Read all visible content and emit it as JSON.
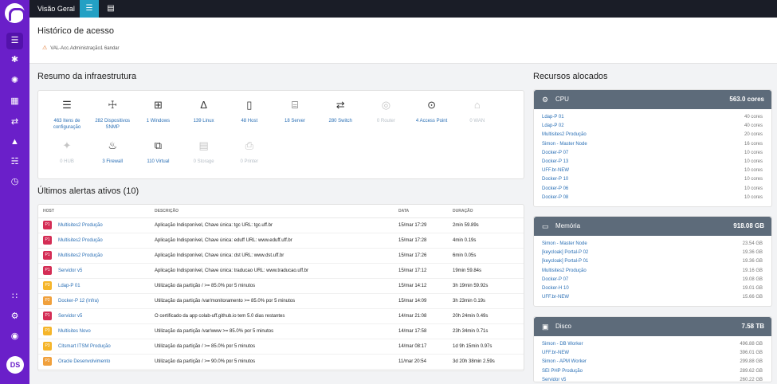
{
  "app": {
    "section_title": "Visão Geral",
    "user_initials": "DS"
  },
  "header": {
    "title": "Histórico de acesso",
    "warning": "VAL-Acc.Administração1 6andar"
  },
  "infra": {
    "title": "Resumo da infraestrutura",
    "items": [
      {
        "label": "463 Itens de configuração",
        "icon": "server-icon",
        "on": true
      },
      {
        "label": "282 Dispositivos SNMP",
        "icon": "snmp-icon",
        "on": true
      },
      {
        "label": "1 Windows",
        "icon": "windows-icon",
        "on": true
      },
      {
        "label": "139 Linux",
        "icon": "linux-icon",
        "on": true
      },
      {
        "label": "48 Host",
        "icon": "host-icon",
        "on": true
      },
      {
        "label": "18 Server",
        "icon": "server-rack-icon",
        "on": true
      },
      {
        "label": "280 Switch",
        "icon": "switch-icon",
        "on": true
      },
      {
        "label": "0 Router",
        "icon": "router-icon",
        "on": false
      },
      {
        "label": "4 Access Point",
        "icon": "access-point-icon",
        "on": true
      },
      {
        "label": "0 WAN",
        "icon": "wan-icon",
        "on": false
      },
      {
        "label": "0 HUB",
        "icon": "hub-icon",
        "on": false
      },
      {
        "label": "3 Firewall",
        "icon": "firewall-icon",
        "on": true
      },
      {
        "label": "110 Virtual",
        "icon": "virtual-icon",
        "on": true
      },
      {
        "label": "0 Storage",
        "icon": "storage-icon",
        "on": false
      },
      {
        "label": "0 Printer",
        "icon": "printer-icon",
        "on": false
      }
    ]
  },
  "alerts": {
    "title": "Últimos alertas ativos (10)",
    "columns": [
      "HOST",
      "DESCRIÇÃO",
      "DATA",
      "DURAÇÃO"
    ],
    "rows": [
      {
        "p": "P1",
        "host": "Multisites2 Produção",
        "desc": "Aplicação Indisponível, Chave única: tgc URL: tgc.uff.br",
        "date": "15/mar 17:29",
        "dur": "2min 59.89s"
      },
      {
        "p": "P1",
        "host": "Multisites2 Produção",
        "desc": "Aplicação Indisponível, Chave única: eduff URL: www.eduff.uff.br",
        "date": "15/mar 17:28",
        "dur": "4min 0.19s"
      },
      {
        "p": "P1",
        "host": "Multisites2 Produção",
        "desc": "Aplicação Indisponível, Chave única: dst URL: www.dst.uff.br",
        "date": "15/mar 17:26",
        "dur": "6min 0.05s"
      },
      {
        "p": "P1",
        "host": "Servidor v5",
        "desc": "Aplicação Indisponível, Chave única: traducao URL: www.traducao.uff.br",
        "date": "15/mar 17:12",
        "dur": "19min 59.84s"
      },
      {
        "p": "P3",
        "host": "Ldap-P 01",
        "desc": "Utilização da partição / >= 85.0% por 5 minutos",
        "date": "15/mar 14:12",
        "dur": "3h 19min 59.92s"
      },
      {
        "p": "P2",
        "host": "Docker-P 12 (Infra)",
        "desc": "Utilização da partição /var/monitoramento >= 85.0% por 5 minutos",
        "date": "15/mar 14:09",
        "dur": "3h 23min 0.19s"
      },
      {
        "p": "P1",
        "host": "Servidor v5",
        "desc": "O certificado da app colab-uff.github.io tem 5.0 dias restantes",
        "date": "14/mar 21:08",
        "dur": "20h 24min 0.49s"
      },
      {
        "p": "P3",
        "host": "Multisites Novo",
        "desc": "Utilização da partição /var/www >= 85.0% por 5 minutos",
        "date": "14/mar 17:58",
        "dur": "23h 34min 0.71s"
      },
      {
        "p": "P3",
        "host": "Citsmart ITSM Produção",
        "desc": "Utilização da partição / >= 85.0% por 5 minutos",
        "date": "14/mar 08:17",
        "dur": "1d 9h 15min 0.97s"
      },
      {
        "p": "P2",
        "host": "Oracle Desenvolvimento",
        "desc": "Utilização da partição / >= 90.0% por 5 minutos",
        "date": "11/mar 20:54",
        "dur": "3d 20h 38min 2.59s"
      }
    ]
  },
  "resources": {
    "title": "Recursos alocados",
    "cards": [
      {
        "name": "CPU",
        "total": "563.0 cores",
        "icon": "cpu-icon",
        "rows": [
          {
            "n": "Ldap-P 01",
            "v": "40 cores"
          },
          {
            "n": "Ldap-P 02",
            "v": "40 cores"
          },
          {
            "n": "Multisites2 Produção",
            "v": "20 cores"
          },
          {
            "n": "Simon - Master Node",
            "v": "16 cores"
          },
          {
            "n": "Docker-P 07",
            "v": "10 cores"
          },
          {
            "n": "Docker-P 13",
            "v": "10 cores"
          },
          {
            "n": "UFF.br-NEW",
            "v": "10 cores"
          },
          {
            "n": "Docker-P 10",
            "v": "10 cores"
          },
          {
            "n": "Docker-P 06",
            "v": "10 cores"
          },
          {
            "n": "Docker-P 08",
            "v": "10 cores"
          }
        ]
      },
      {
        "name": "Memória",
        "total": "918.08 GB",
        "icon": "memory-icon",
        "rows": [
          {
            "n": "Simon - Master Node",
            "v": "23.54 GB"
          },
          {
            "n": "[keycloak] Portal-P 02",
            "v": "19.36 GB"
          },
          {
            "n": "[keycloak] Portal-P 01",
            "v": "19.36 GB"
          },
          {
            "n": "Multisites2 Produção",
            "v": "19.16 GB"
          },
          {
            "n": "Docker-P 07",
            "v": "19.08 GB"
          },
          {
            "n": "Docker-H 10",
            "v": "19.01 GB"
          },
          {
            "n": "UFF.br-NEW",
            "v": "15.66 GB"
          }
        ]
      },
      {
        "name": "Disco",
        "total": "7.58 TB",
        "icon": "disk-icon",
        "rows": [
          {
            "n": "Simon - DB Worker",
            "v": "496.88 GB"
          },
          {
            "n": "UFF.br-NEW",
            "v": "396.01 GB"
          },
          {
            "n": "Simon - APM Worker",
            "v": "299.88 GB"
          },
          {
            "n": "SEI PHP Produção",
            "v": "289.62 GB"
          },
          {
            "n": "Servidor v5",
            "v": "260.22 GB"
          }
        ]
      }
    ]
  }
}
